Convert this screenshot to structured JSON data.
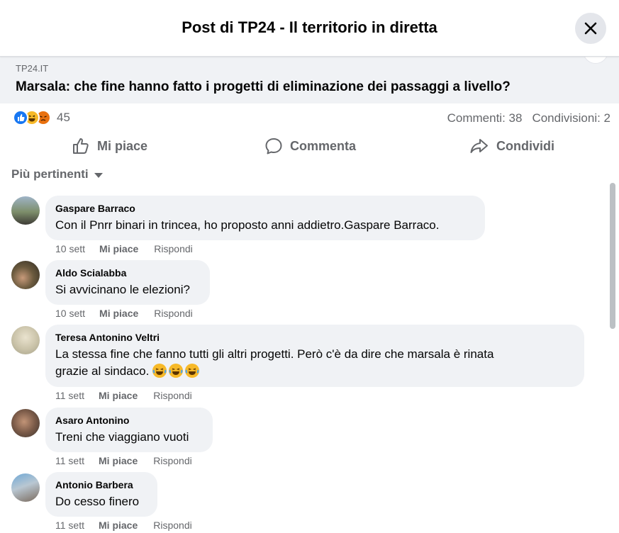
{
  "header": {
    "title": "Post di TP24 - Il territorio in diretta"
  },
  "link_preview": {
    "domain": "TP24.IT",
    "title": "Marsala: che fine hanno fatto i progetti di eliminazione dei passaggi a livello?"
  },
  "reactions": {
    "count": "45",
    "types": [
      "like-icon",
      "haha-icon",
      "angry-icon"
    ],
    "colors": {
      "like": "#1877f2",
      "haha": "#f7b928",
      "angry": "#e9710f"
    }
  },
  "stats": {
    "comments": "Commenti: 38",
    "shares": "Condivisioni: 2"
  },
  "actions": {
    "like": "Mi piace",
    "comment": "Commenta",
    "share": "Condividi"
  },
  "filter": {
    "label": "Più pertinenti"
  },
  "comments": [
    {
      "author": "Gaspare Barraco",
      "text": "Con il Pnrr binari in trincea, ho proposto anni addietro.Gaspare Barraco.",
      "time": "10 sett",
      "like": "Mi piace",
      "reply": "Rispondi"
    },
    {
      "author": "Aldo Scialabba",
      "text": "Si avvicinano le elezioni?",
      "time": "10 sett",
      "like": "Mi piace",
      "reply": "Rispondi"
    },
    {
      "author": "Teresa Antonino Veltri",
      "text_line1": "La stessa fine che fanno tutti gli altri progetti. Però c'è da dire che marsala è rinata",
      "text_line2": "grazie al sindaco.",
      "emojis": [
        "laughing-tears-emoji",
        "laughing-tears-emoji",
        "laughing-tears-emoji"
      ],
      "time": "11 sett",
      "like": "Mi piace",
      "reply": "Rispondi"
    },
    {
      "author": "Asaro Antonino",
      "text": "Treni che viaggiano vuoti",
      "time": "11 sett",
      "like": "Mi piace",
      "reply": "Rispondi"
    },
    {
      "author": "Antonio Barbera",
      "text": "Do cesso finero",
      "time": "11 sett",
      "like": "Mi piace",
      "reply": "Rispondi"
    }
  ]
}
